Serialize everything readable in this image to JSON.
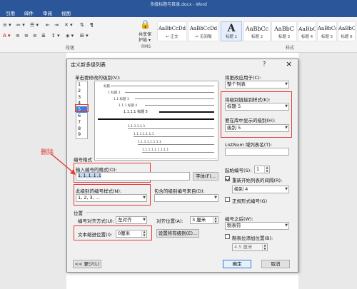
{
  "word": {
    "document_title": "多级标题与目录.docx - Word",
    "menu_tabs": [
      "引用",
      "邮件",
      "审阅",
      "视图"
    ],
    "group_labels": {
      "paragraph": "段落",
      "rms": "RMS",
      "styles": "样式"
    },
    "share_button": {
      "line1": "共享保",
      "line2": "护链 ▾"
    },
    "style_gallery": [
      {
        "sample": "AaBbCcDd",
        "name": "↵ 正文"
      },
      {
        "sample": "AaBbCcDd",
        "name": "↵ 无间隔"
      },
      {
        "sample": "A",
        "name": "标题 1"
      },
      {
        "sample": "AaBbCc",
        "name": "标题 2"
      },
      {
        "sample": "AaBbC",
        "name": "标题 3"
      },
      {
        "sample": "AaBbCc",
        "name": "标题 4"
      },
      {
        "sample": "AaBbCcI",
        "name": "标题 5"
      },
      {
        "sample": "AaBbCcD",
        "name": "标题 6"
      }
    ]
  },
  "dialog": {
    "title": "定义新多级列表",
    "help": "?",
    "close": "×",
    "click_level_label": "单击要修改的级别(V):",
    "levels": [
      "1",
      "2",
      "3",
      "4",
      "5",
      "6",
      "7",
      "8",
      "9"
    ],
    "selected_level": "5",
    "preview": {
      "l1": "标题",
      "l2": "1 标题 2",
      "l3": "1.1 标题 3",
      "l4": "1.1.1 标题 4",
      "l5": "1.1.1.1 标题 5",
      "l7": "1.1.1.1.1.1",
      "l8": "1.1.1.1.1.1.1",
      "l9": "1.1.1.1.1.1.1.1",
      "l10": "1.1.1.1.1.1.1.1.1"
    },
    "apply_to_label": "将更改应用于(C):",
    "apply_to_value": "整个列表",
    "link_style_label": "将级别链接到样式(K):",
    "link_style_value": "标题 5",
    "gallery_level_label": "要在库中显示的级别(H):",
    "gallery_level_value": "级别 5",
    "listnum_label": "ListNum 域列表名(T):",
    "listnum_value": "",
    "number_format_section": "编号格式",
    "enter_format_label": "输入编号的格式(O):",
    "format_value": "1.1.1.1.1",
    "font_button": "字体(F)...",
    "number_style_label": "此级别的编号样式(N):",
    "number_style_value": "1, 2, 3, ...",
    "include_level_label": "包含的级别编号来自(D):",
    "include_level_value": "",
    "start_at_label": "起始编号(S):",
    "start_at_value": "1",
    "restart_label": "重新开始列表的间隔(R):",
    "restart_value": "级别 4",
    "legal_label": "正规形式编号(G)",
    "position_section": "位置",
    "alignment_label": "编号对齐方式(U):",
    "alignment_value": "左对齐",
    "aligned_at_label": "对齐位置(A):",
    "aligned_at_value": "3 厘米",
    "follow_label": "编号之后(W):",
    "follow_value": "制表符",
    "indent_label": "文本缩进位置(I):",
    "indent_value": "0厘米",
    "set_all_button": "设置所有级别(E)...",
    "tab_stop_label": "制表位添加位置(B):",
    "tab_stop_value": "4.5 厘米",
    "less_button": "<< 更少(L)",
    "ok_button": "确定",
    "cancel_button": "取消"
  },
  "annotation": {
    "text": "删除"
  },
  "colors": {
    "title_blue": "#2b579a",
    "annotation_red": "#e53935",
    "selected_level_blue": "#3c7fd8"
  }
}
